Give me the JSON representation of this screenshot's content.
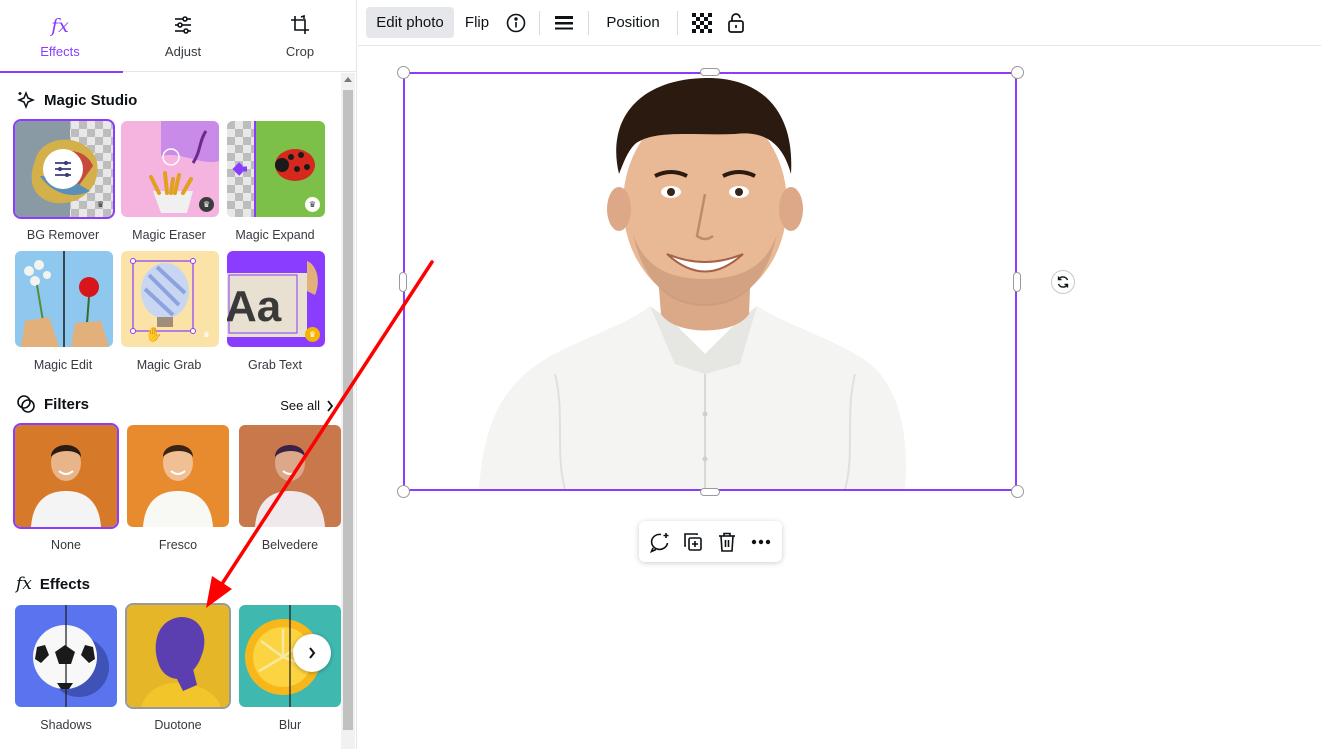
{
  "tabs": [
    {
      "label": "Effects",
      "icon": "fx-icon",
      "active": true
    },
    {
      "label": "Adjust",
      "icon": "sliders-icon",
      "active": false
    },
    {
      "label": "Crop",
      "icon": "crop-icon",
      "active": false
    }
  ],
  "magic_studio": {
    "title": "Magic Studio",
    "items": [
      {
        "label": "BG Remover"
      },
      {
        "label": "Magic Eraser"
      },
      {
        "label": "Magic Expand"
      },
      {
        "label": "Magic Edit"
      },
      {
        "label": "Magic Grab"
      },
      {
        "label": "Grab Text"
      }
    ],
    "grab_text_sample": "Aa"
  },
  "filters": {
    "title": "Filters",
    "see_all": "See all",
    "items": [
      {
        "label": "None"
      },
      {
        "label": "Fresco"
      },
      {
        "label": "Belvedere"
      }
    ]
  },
  "effects": {
    "title": "Effects",
    "items": [
      {
        "label": "Shadows"
      },
      {
        "label": "Duotone"
      },
      {
        "label": "Blur"
      }
    ]
  },
  "toolbar": {
    "edit_photo": "Edit photo",
    "flip": "Flip",
    "position": "Position"
  },
  "colors": {
    "accent": "#8b3dff",
    "annotation_arrow": "#ff0000"
  }
}
